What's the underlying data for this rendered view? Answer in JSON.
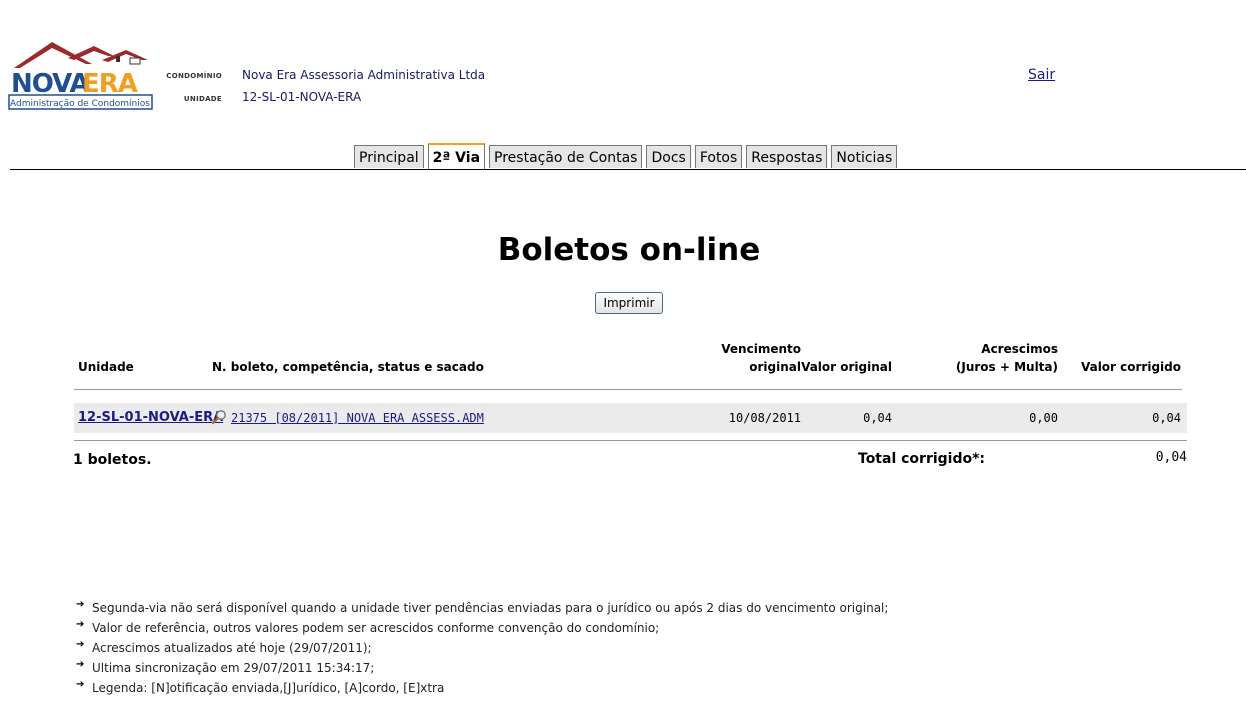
{
  "header": {
    "logo_text": "NOVAERA",
    "logo_subtitle": "Administração de Condomínios",
    "condominio_label": "CONDOMÍNIO",
    "condominio_value": "Nova Era Assessoria Administrativa Ltda",
    "unidade_label": "UNIDADE",
    "unidade_value": "12-SL-01-NOVA-ERA",
    "logout_label": "Sair"
  },
  "tabs": [
    {
      "label": "Principal",
      "active": false
    },
    {
      "label": "2ª Via",
      "active": true
    },
    {
      "label": "Prestação de Contas",
      "active": false
    },
    {
      "label": "Docs",
      "active": false
    },
    {
      "label": "Fotos",
      "active": false
    },
    {
      "label": "Respostas",
      "active": false
    },
    {
      "label": "Noticias",
      "active": false
    }
  ],
  "page_title": "Boletos on-line",
  "print_button": "Imprimir",
  "table": {
    "headers": {
      "unidade": "Unidade",
      "boleto": "N. boleto, competência, status e sacado",
      "vencimento_1": "Vencimento",
      "vencimento_2": "original",
      "valor_original": "Valor original",
      "acrescimos_1": "Acrescimos",
      "acrescimos_2": "(Juros + Multa)",
      "valor_corrigido": "Valor corrigido"
    },
    "rows": [
      {
        "unidade": "12-SL-01-NOVA-ERA",
        "boleto": "21375 [08/2011] NOVA ERA ASSESS.ADM",
        "vencimento": "10/08/2011",
        "valor_original": "0,04",
        "acrescimos": "0,00",
        "valor_corrigido": "0,04"
      }
    ],
    "count_label": "1 boletos.",
    "total_label": "Total corrigido*:",
    "total_value": "0,04"
  },
  "notes": [
    "Segunda-via não será disponível quando a unidade tiver pendências enviadas para o jurídico ou após 2 dias do vencimento original;",
    "Valor de referência, outros valores podem ser acrescidos conforme convenção do condomínio;",
    "Acrescimos atualizados até hoje (29/07/2011);",
    "Ultima sincronização em 29/07/2011 15:34:17;",
    "Legenda: [N]otificação enviada,[J]urídico, [A]cordo, [E]xtra"
  ],
  "colors": {
    "logo_blue": "#1f4f8f",
    "logo_orange": "#f0a020",
    "roof_red": "#9b2a2a",
    "active_tab_accent": "#f0a020"
  }
}
